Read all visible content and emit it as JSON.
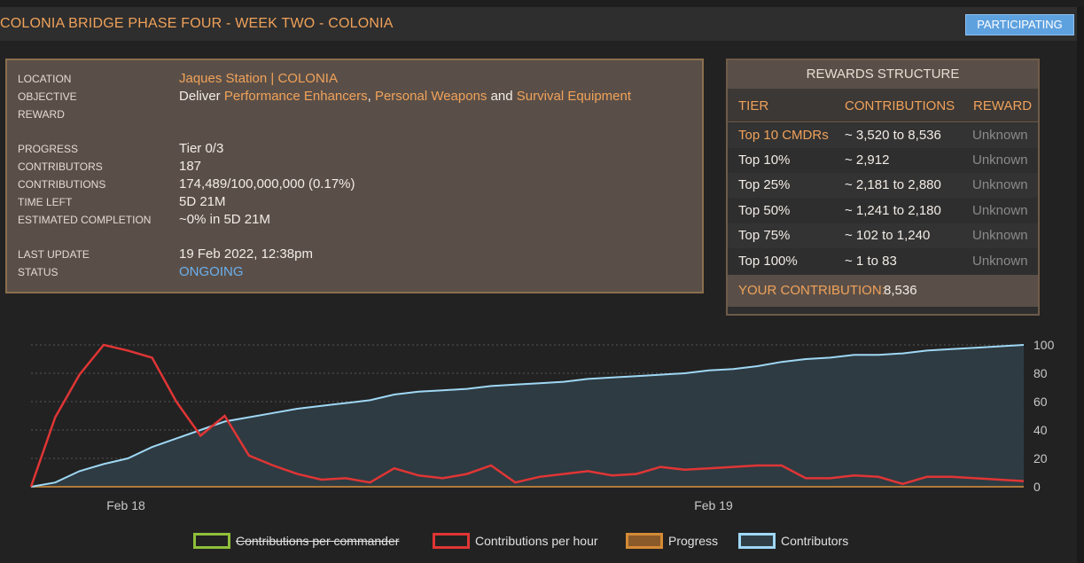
{
  "header": {
    "title": "COLONIA BRIDGE PHASE FOUR - WEEK TWO - COLONIA",
    "status_button": "PARTICIPATING"
  },
  "info": {
    "location_label": "LOCATION",
    "location_value": "Jaques Station | COLONIA",
    "objective_label": "OBJECTIVE",
    "objective_prefix": "Deliver",
    "commodity_1": "Performance Enhancers",
    "comma": ",",
    "commodity_2": "Personal Weapons",
    "and_word": "and",
    "commodity_3": "Survival Equipment",
    "reward_label": "REWARD",
    "progress_label": "PROGRESS",
    "progress_value": "Tier 0/3",
    "contributors_label": "CONTRIBUTORS",
    "contributors_value": "187",
    "contributions_label": "CONTRIBUTIONS",
    "contributions_value": "174,489/100,000,000 (0.17%)",
    "time_left_label": "TIME LEFT",
    "time_left_value": "5D 21M",
    "est_label": "ESTIMATED COMPLETION",
    "est_value": "~0% in 5D 21M",
    "last_update_label": "LAST UPDATE",
    "last_update_value": "19 Feb 2022, 12:38pm",
    "status_label": "STATUS",
    "status_value": "ONGOING"
  },
  "rewards": {
    "title": "REWARDS STRUCTURE",
    "col_tier": "TIER",
    "col_contrib": "CONTRIBUTIONS",
    "col_reward": "REWARD",
    "rows": [
      {
        "tier": "Top 10 CMDRs",
        "contrib": "~ 3,520 to 8,536",
        "reward": "Unknown"
      },
      {
        "tier": "Top 10%",
        "contrib": "~ 2,912",
        "reward": "Unknown"
      },
      {
        "tier": "Top 25%",
        "contrib": "~ 2,181 to 2,880",
        "reward": "Unknown"
      },
      {
        "tier": "Top 50%",
        "contrib": "~ 1,241 to 2,180",
        "reward": "Unknown"
      },
      {
        "tier": "Top 75%",
        "contrib": "~ 102 to 1,240",
        "reward": "Unknown"
      },
      {
        "tier": "Top 100%",
        "contrib": "~ 1 to 83",
        "reward": "Unknown"
      }
    ],
    "your_label": "YOUR CONTRIBUTION:",
    "your_value": "8,536"
  },
  "colors": {
    "accent_orange": "#f0a25a",
    "status_blue": "#6ab0f0",
    "button_blue": "#5ea1df",
    "line_red": "#e03535",
    "line_lightblue": "#9fd8f5",
    "legend_green": "#8fbf3a",
    "legend_brown": "#b07a3a"
  },
  "chart_data": {
    "type": "line",
    "y_ticks": [
      "0",
      "20",
      "40",
      "60",
      "80",
      "100"
    ],
    "ylim": [
      0,
      100
    ],
    "x_ticks": [
      "Feb 18",
      "Feb 19"
    ],
    "grid": true,
    "legend_position": "bottom",
    "series": [
      {
        "name": "Contributions per commander",
        "hidden": true,
        "values": []
      },
      {
        "name": "Contributions per hour",
        "values": [
          0,
          49,
          79,
          100,
          96,
          91,
          60,
          36,
          50,
          22,
          15,
          9,
          5,
          6,
          3,
          13,
          8,
          6,
          9,
          15,
          3,
          7,
          9,
          11,
          8,
          9,
          14,
          12,
          13,
          14,
          15,
          15,
          6,
          6,
          8,
          7,
          2,
          7,
          7,
          6,
          5,
          4
        ]
      },
      {
        "name": "Progress",
        "values": []
      },
      {
        "name": "Contributors",
        "values": [
          0,
          3,
          11,
          16,
          20,
          28,
          34,
          40,
          46,
          49,
          52,
          55,
          57,
          59,
          61,
          65,
          67,
          68,
          69,
          71,
          72,
          73,
          74,
          76,
          77,
          78,
          79,
          80,
          82,
          83,
          85,
          88,
          90,
          91,
          93,
          93,
          94,
          96,
          97,
          98,
          99,
          100
        ]
      }
    ]
  }
}
